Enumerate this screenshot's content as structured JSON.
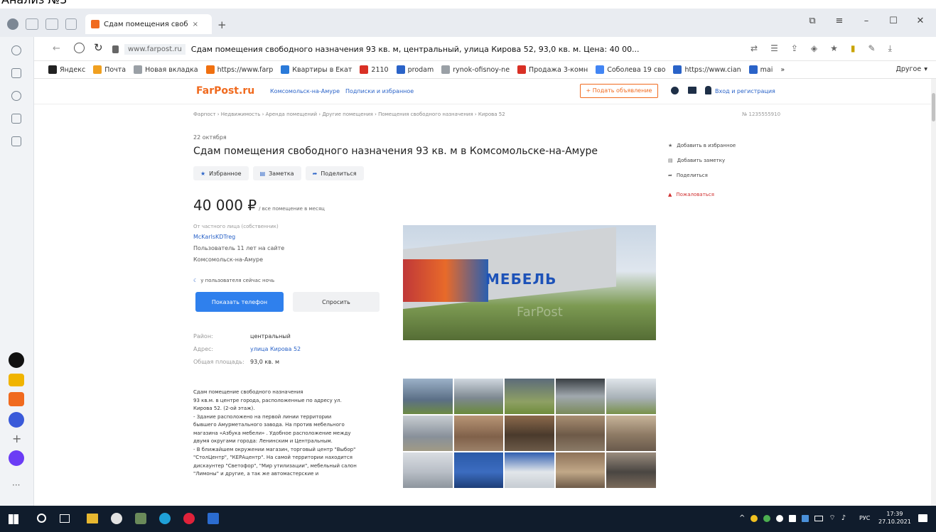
{
  "doc_heading": "Анализ №3",
  "browser": {
    "tab_title": "Сдам помещения своб",
    "new_tab": "+",
    "address_host": "www.farpost.ru",
    "address_title": "Сдам помещения свободного назначения 93 кв. м, центральный, улица Кирова 52, 93,0 кв. м. Цена: 40 00...",
    "bookmarks": [
      {
        "label": "Яндекс",
        "color": "#222222"
      },
      {
        "label": "Почта",
        "color": "#f0a020"
      },
      {
        "label": "Новая вкладка",
        "color": "#9aa0a6"
      },
      {
        "label": "https://www.farp",
        "color": "#f07010"
      },
      {
        "label": "Квартиры в Екат",
        "color": "#2a7ad9"
      },
      {
        "label": "2110",
        "color": "#d93025"
      },
      {
        "label": "prodam",
        "color": "#2a63c8"
      },
      {
        "label": "rynok-ofisnoy-ne",
        "color": "#9aa0a6"
      },
      {
        "label": "Продажа 3-комн",
        "color": "#d93025"
      },
      {
        "label": "Соболева 19 сво",
        "color": "#4285f4"
      },
      {
        "label": "https://www.cian",
        "color": "#2a63c8"
      },
      {
        "label": "mai",
        "color": "#2a63c8"
      }
    ],
    "bookmarks_more": "»",
    "bookmarks_other": "Другое"
  },
  "site": {
    "logo": "FarPost.ru",
    "city_link": "Комсомольск-на-Амуре",
    "subs_link": "Подписки и избранное",
    "post_button": "+ Подать объявление",
    "login_link": "Вход и регистрация"
  },
  "listing": {
    "breadcrumbs": "Фарпост › Недвижимость › Аренда помещений › Другие помещения › Помещения свободного назначения › Кирова 52",
    "listing_id": "№ 1235555910",
    "date": "22 октября",
    "title": "Сдам помещения свободного назначения 93 кв. м в Комсомольске-на-Амуре",
    "actions": [
      "Избранное",
      "Заметка",
      "Поделиться"
    ],
    "price": "40 000 ₽",
    "price_note": "/ все помещение в месяц",
    "seller_type": "От частного лица (собственник)",
    "seller_name": "McKarlsKDTreg",
    "seller_since": "Пользователь 11 лет на сайте",
    "seller_city": "Комсомольск-на-Амуре",
    "seller_time": "у пользователя сейчас ночь",
    "show_phone": "Показать телефон",
    "ask_button": "Спросить",
    "params": [
      {
        "k": "Район:",
        "v": "центральный"
      },
      {
        "k": "Адрес:",
        "v": "улица Кирова 52"
      },
      {
        "k": "Общая площадь:",
        "v": "93,0 кв. м"
      }
    ],
    "description": [
      "Сдам помещение свободного назначения",
      "93 кв.м. в центре города, расположенные по адресу ул.",
      "Кирова 52. (2-ой этаж).",
      "- Здание расположено на первой линии территории",
      "бывшего Амурметального завода. На против мебельного",
      "магазина «Азбука мебели» . Удобное расположение между",
      "двумя округами города: Ленинским и Центральным.",
      "- В ближайшем окружении магазин, торговый центр \"Выбор\"",
      "\"СтолЦентр\", \"КЕРАцентр\". На самой территории находится",
      "дискаунтер \"Светофор\", \"Мир утилизации\", мебельный салон",
      "\"Лимоны\" и другие, а так же автомастерские и"
    ],
    "photo_sign": "МЕБЕЛЬ",
    "photo_watermark": "FarPost"
  },
  "sidebar": {
    "add_fav": "Добавить в избранное",
    "add_note": "Добавить заметку",
    "share": "Поделиться",
    "complain": "Пожаловаться"
  },
  "taskbar": {
    "lang": "РУС",
    "time": "17:39",
    "date": "27.10.2021"
  },
  "colors": {
    "accent_blue": "#2f80ed",
    "link_blue": "#2a63c8",
    "farpost_orange": "#f06a1e",
    "complain_red": "#d03030",
    "taskbar": "#101c2c"
  }
}
